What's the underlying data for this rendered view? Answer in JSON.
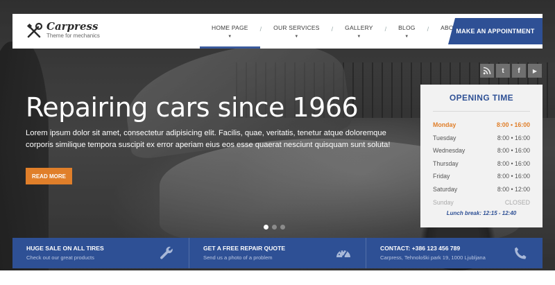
{
  "brand": {
    "name": "Carpress",
    "tagline": "Theme for mechanics",
    "accent_color": "#2e5095",
    "highlight_color": "#e07f2a"
  },
  "nav": {
    "items": [
      {
        "label": "HOME PAGE",
        "active": true
      },
      {
        "label": "OUR SERVICES",
        "active": false
      },
      {
        "label": "GALLERY",
        "active": false
      },
      {
        "label": "BLOG",
        "active": false
      },
      {
        "label": "ABOUT US",
        "active": false
      }
    ],
    "cta_label": "MAKE AN APPOINTMENT"
  },
  "social": [
    {
      "name": "rss-icon"
    },
    {
      "name": "twitter-icon",
      "glyph": "t"
    },
    {
      "name": "facebook-icon",
      "glyph": "f"
    },
    {
      "name": "youtube-icon",
      "glyph": "▶"
    }
  ],
  "hero": {
    "title": "Repairing cars since 1966",
    "description": "Lorem ipsum dolor sit amet, consectetur adipisicing elit. Facilis, quae, veritatis, tenetur atque doloremque corporis similique tempora suscipit ex error aperiam eius eos esse quaerat nesciunt quisquam sunt soluta!",
    "button_label": "READ MORE",
    "slides_count": 3,
    "active_slide": 1
  },
  "opening_time": {
    "title": "OPENING TIME",
    "days": [
      {
        "day": "Monday",
        "hours": "8:00 • 16:00",
        "today": true
      },
      {
        "day": "Tuesday",
        "hours": "8:00 • 16:00"
      },
      {
        "day": "Wednesday",
        "hours": "8:00 • 16:00"
      },
      {
        "day": "Thursday",
        "hours": "8:00 • 16:00"
      },
      {
        "day": "Friday",
        "hours": "8:00 • 16:00"
      },
      {
        "day": "Saturday",
        "hours": "8:00 • 12:00"
      },
      {
        "day": "Sunday",
        "hours": "CLOSED",
        "closed": true
      }
    ],
    "lunch": "Lunch break: 12:15 - 12:40"
  },
  "info_bar": [
    {
      "title": "HUGE SALE ON ALL TIRES",
      "subtitle": "Check out our great products",
      "icon": "wrench-icon"
    },
    {
      "title": "GET A FREE REPAIR QUOTE",
      "subtitle": "Send us a photo of a problem",
      "icon": "speedometer-icon"
    },
    {
      "title": "CONTACT: +386 123 456 789",
      "subtitle": "Carpress, Tehnološki park 19, 1000 Ljubljana",
      "icon": "phone-icon"
    }
  ]
}
